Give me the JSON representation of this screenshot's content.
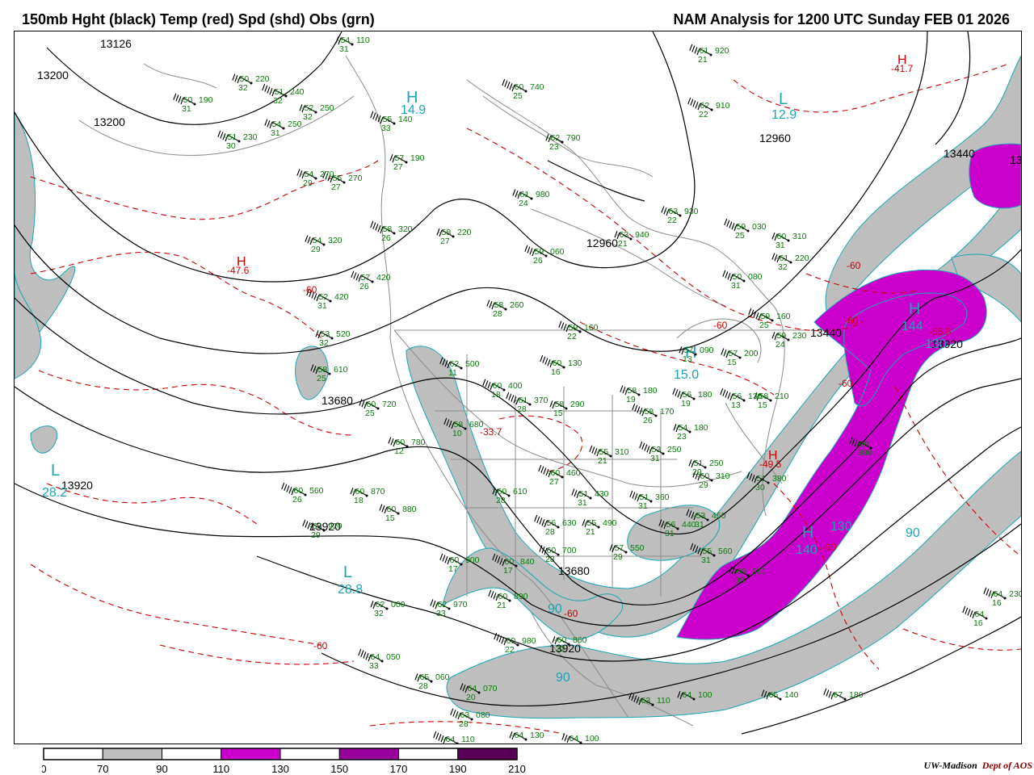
{
  "title_left": "150mb Hght (black) Temp (red) Spd (shd) Obs (grn)",
  "title_right": "NAM Analysis for 1200 UTC Sunday  FEB 01 2026",
  "credit": {
    "org": "UW-Madison",
    "dept": "Dept of AOS"
  },
  "colors": {
    "height_contour": "#000000",
    "temperature": "#cc0000",
    "speed_70_90": "#bebebe",
    "speed_110_130": "#cc00cc",
    "observations": "#0a7a0a",
    "high_low": "#1aa6b4",
    "borders": "#8c8c8c"
  },
  "legend": {
    "labels": [
      "0",
      "70",
      "90",
      "110",
      "130",
      "150",
      "170",
      "190",
      "210"
    ],
    "bins": [
      {
        "from": 0,
        "to": 70,
        "color": "#ffffff"
      },
      {
        "from": 70,
        "to": 90,
        "color": "#bebebe"
      },
      {
        "from": 90,
        "to": 110,
        "color": "#ffffff"
      },
      {
        "from": 110,
        "to": 130,
        "color": "#cc00cc"
      },
      {
        "from": 130,
        "to": 150,
        "color": "#ffffff"
      },
      {
        "from": 150,
        "to": 170,
        "color": "#99009c"
      },
      {
        "from": 170,
        "to": 190,
        "color": "#ffffff"
      },
      {
        "from": 190,
        "to": 210,
        "color": "#5a005a"
      }
    ]
  },
  "height_labels": [
    "13126",
    "13200",
    "13200",
    "12960",
    "12960",
    "13440",
    "13440",
    "13920",
    "13680",
    "13920",
    "13920",
    "13680",
    "13920",
    "13680"
  ],
  "high_low_labels": [
    {
      "text": "H",
      "value": "14.9"
    },
    {
      "text": "L",
      "value": "12.9"
    },
    {
      "text": "H",
      "value": "15.0"
    },
    {
      "text": "H",
      "value": "144"
    },
    {
      "text": "H",
      "value": "140"
    },
    {
      "text": "L",
      "value": "28.2"
    },
    {
      "text": "L",
      "value": "28.8"
    },
    {
      "text": "H",
      "value": "-47.6"
    },
    {
      "text": "H",
      "value": "-41.7"
    },
    {
      "text": "H",
      "value": "-49.5"
    }
  ],
  "speed_labels": [
    "90",
    "90",
    "90",
    "130",
    "130",
    "-60",
    "-60",
    "-60",
    "-60",
    "-60",
    "-60",
    "-60",
    "-60",
    "-33.7",
    "-55.6"
  ],
  "observations": [
    {
      "t": "-54",
      "d": "31",
      "h": "110"
    },
    {
      "t": "-50",
      "d": "32",
      "h": "220"
    },
    {
      "t": "-50",
      "d": "31",
      "h": "190"
    },
    {
      "t": "-51",
      "d": "32",
      "h": "240"
    },
    {
      "t": "-52",
      "d": "32",
      "h": "250"
    },
    {
      "t": "-54",
      "d": "31",
      "h": "250"
    },
    {
      "t": "-51",
      "d": "30",
      "h": "230"
    },
    {
      "t": "-55",
      "d": "33",
      "h": "140"
    },
    {
      "t": "-57",
      "d": "27",
      "h": "190"
    },
    {
      "t": "-54",
      "d": "29",
      "h": "270"
    },
    {
      "t": "-55",
      "d": "27",
      "h": "270"
    },
    {
      "t": "-58",
      "d": "26",
      "h": "320"
    },
    {
      "t": "-58",
      "d": "27",
      "h": "220"
    },
    {
      "t": "-54",
      "d": "29",
      "h": "320"
    },
    {
      "t": "-57",
      "d": "26",
      "h": "420"
    },
    {
      "t": "-60",
      "d": "25",
      "h": "740"
    },
    {
      "t": "-62",
      "d": "23",
      "h": "790"
    },
    {
      "t": "-61",
      "d": "24",
      "h": "980"
    },
    {
      "t": "-61",
      "d": "21",
      "h": "920"
    },
    {
      "t": "-62",
      "d": "22",
      "h": "910"
    },
    {
      "t": "-63",
      "d": "21",
      "h": "940"
    },
    {
      "t": "-63",
      "d": "22",
      "h": "930"
    },
    {
      "t": "-59",
      "d": "26",
      "h": "060"
    },
    {
      "t": "-59",
      "d": "25",
      "h": "030"
    },
    {
      "t": "-60",
      "d": "31",
      "h": "310"
    },
    {
      "t": "-61",
      "d": "32",
      "h": "220"
    },
    {
      "t": "-50",
      "d": "31",
      "h": "080"
    },
    {
      "t": "-52",
      "d": "31",
      "h": "420"
    },
    {
      "t": "-53",
      "d": "32",
      "h": "520"
    },
    {
      "t": "-58",
      "d": "28",
      "h": "260"
    },
    {
      "t": "-59",
      "d": "22",
      "h": "160"
    },
    {
      "t": "-59",
      "d": "25",
      "h": "160"
    },
    {
      "t": "-59",
      "d": "24",
      "h": "230"
    },
    {
      "t": "-58",
      "d": "25",
      "h": "610"
    },
    {
      "t": "-62",
      "d": "11",
      "h": "500"
    },
    {
      "t": "-60",
      "d": "16",
      "h": "130"
    },
    {
      "t": "-57",
      "d": "13",
      "h": "090"
    },
    {
      "t": "-57",
      "d": "15",
      "h": "200"
    },
    {
      "t": "-60",
      "d": "18",
      "h": "400"
    },
    {
      "t": "-61",
      "d": "28",
      "h": "370"
    },
    {
      "t": "-58",
      "d": "15",
      "h": "290"
    },
    {
      "t": "-58",
      "d": "19",
      "h": "180"
    },
    {
      "t": "-56",
      "d": "19",
      "h": "180"
    },
    {
      "t": "-56",
      "d": "13",
      "h": "130"
    },
    {
      "t": "-58",
      "d": "15",
      "h": "210"
    },
    {
      "t": "-60",
      "d": "25",
      "h": "720"
    },
    {
      "t": "-58",
      "d": "10",
      "h": "680"
    },
    {
      "t": "-58",
      "d": "26",
      "h": "170"
    },
    {
      "t": "-54",
      "d": "23",
      "h": "180"
    },
    {
      "t": "-60",
      "d": "12",
      "h": "780"
    },
    {
      "t": "-55",
      "d": "21",
      "h": "310"
    },
    {
      "t": "-53",
      "d": "31",
      "h": "250"
    },
    {
      "t": "-51",
      "d": "29",
      "h": "250"
    },
    {
      "t": "-60",
      "d": "29",
      "h": "310"
    },
    {
      "t": "-51",
      "d": "30",
      "h": "380"
    },
    {
      "t": "-60",
      "d": "27",
      "h": "460"
    },
    {
      "t": "-60",
      "d": "28",
      "h": "610"
    },
    {
      "t": "-51",
      "d": "31",
      "h": "430"
    },
    {
      "t": "-51",
      "d": "31",
      "h": "360"
    },
    {
      "t": "-60",
      "d": "26",
      "h": "560"
    },
    {
      "t": "-60",
      "d": "18",
      "h": "870"
    },
    {
      "t": "-60",
      "d": "15",
      "h": "880"
    },
    {
      "t": "-60",
      "d": "29",
      "h": "920"
    },
    {
      "t": "-56",
      "d": "28",
      "h": "630"
    },
    {
      "t": "-55",
      "d": "21",
      "h": "490"
    },
    {
      "t": "-56",
      "d": "31",
      "h": "440"
    },
    {
      "t": "-53",
      "d": "31",
      "h": "450"
    },
    {
      "t": "-55",
      "d": "31",
      "h": "560"
    },
    {
      "t": "-57",
      "d": "29",
      "h": "550"
    },
    {
      "t": "-60",
      "d": "28",
      "h": "700"
    },
    {
      "t": "-60",
      "d": "17",
      "h": "900"
    },
    {
      "t": "-60",
      "d": "17",
      "h": "840"
    },
    {
      "t": "-62",
      "d": "32",
      "h": "000"
    },
    {
      "t": "-62",
      "d": "33",
      "h": "970"
    },
    {
      "t": "-60",
      "d": "21",
      "h": "890"
    },
    {
      "t": "-60",
      "d": "22",
      "h": "980"
    },
    {
      "t": "-60",
      "d": "22",
      "h": "860"
    },
    {
      "t": "-60",
      "d": "30",
      "h": "080"
    },
    {
      "t": "-60",
      "d": "300",
      "h": ""
    },
    {
      "t": "-64",
      "d": "33",
      "h": "050"
    },
    {
      "t": "-65",
      "d": "28",
      "h": "060"
    },
    {
      "t": "-64",
      "d": "20",
      "h": "070"
    },
    {
      "t": "-63",
      "d": "28",
      "h": "080"
    },
    {
      "t": "-63",
      "d": "",
      "h": "110"
    },
    {
      "t": "-64",
      "d": "",
      "h": "100"
    },
    {
      "t": "-65",
      "d": "",
      "h": "140"
    },
    {
      "t": "-67",
      "d": "",
      "h": "180"
    },
    {
      "t": "-64",
      "d": "",
      "h": "110"
    },
    {
      "t": "-64",
      "d": "",
      "h": "130"
    },
    {
      "t": "-64",
      "d": "",
      "h": "100"
    },
    {
      "t": "-64",
      "d": "16",
      "h": "230"
    },
    {
      "t": "-64",
      "d": "16",
      "h": ""
    }
  ]
}
